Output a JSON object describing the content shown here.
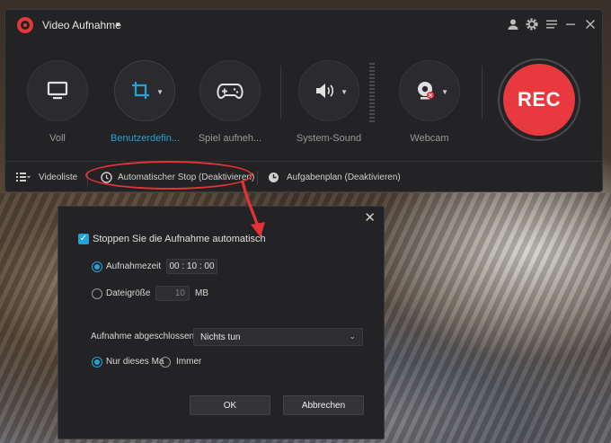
{
  "window": {
    "title": "Video Aufnahme",
    "title_caret": "▾"
  },
  "titlebar_icons": [
    "account-icon",
    "gear-icon",
    "menu-icon",
    "minimize-icon",
    "close-icon"
  ],
  "modes": [
    {
      "label": "Voll",
      "icon": "monitor-icon",
      "active": false
    },
    {
      "label": "Benutzerdefin...",
      "icon": "crop-icon",
      "active": true
    },
    {
      "label": "Spiel aufneh...",
      "icon": "gamepad-icon",
      "active": false
    },
    {
      "label": "System-Sound",
      "icon": "speaker-icon",
      "active": false
    },
    {
      "label": "Webcam",
      "icon": "webcam-icon",
      "active": false
    }
  ],
  "rec": {
    "label": "REC"
  },
  "bottombar": {
    "videolist": "Videoliste",
    "autostop": "Automatischer Stop (Deaktivieren)",
    "schedule": "Aufgabenplan (Deaktivieren)"
  },
  "dialog": {
    "close": "✕",
    "auto_stop_label": "Stoppen Sie die Aufnahme automatisch",
    "auto_stop_checked": true,
    "check_glyph": "✓",
    "duration_label": "Aufnahmezeit",
    "duration_value": "00 : 10 : 00",
    "filesize_label": "Dateigröße",
    "filesize_value": "10",
    "filesize_unit": "MB",
    "selected_mode": "Aufnahmezeit",
    "finished_label": "Aufnahme abgeschlossen",
    "finished_value": "Nichts tun",
    "chevron": "⌄",
    "once_label": "Nur dieses Ma",
    "always_label": "Immer",
    "selected_repeat": "Nur dieses Mal",
    "ok": "OK",
    "cancel": "Abbrechen"
  },
  "colors": {
    "accent": "#21a3d5",
    "rec": "#e8393e",
    "annotation": "#e53236",
    "panel": "#232326"
  }
}
